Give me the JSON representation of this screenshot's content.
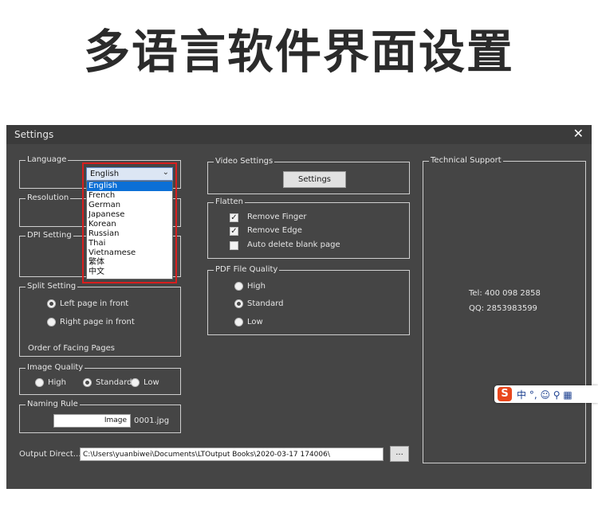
{
  "banner": {
    "title": "多语言软件界面设置"
  },
  "window": {
    "title": "Settings",
    "close": "✕"
  },
  "language": {
    "label": "Language",
    "selected": "English",
    "options": [
      "English",
      "French",
      "German",
      "Japanese",
      "Korean",
      "Russian",
      "Thai",
      "Vietnamese",
      "繁体",
      "中文"
    ]
  },
  "resolution": {
    "label": "Resolution"
  },
  "dpi": {
    "label": "DPI Setting"
  },
  "split": {
    "label": "Split Setting",
    "left": "Left page in front",
    "right": "Right page in front",
    "order": "Order of Facing Pages"
  },
  "image_quality": {
    "label": "Image Quality",
    "high": "High",
    "standard": "Standard",
    "low": "Low"
  },
  "naming": {
    "label": "Naming Rule",
    "value": "Image",
    "suffix": "0001.jpg"
  },
  "output": {
    "label": "Output Direct...",
    "value": "C:\\Users\\yuanbiwei\\Documents\\LTOutput Books\\2020-03-17 174006\\",
    "browse": "..."
  },
  "video": {
    "label": "Video Settings",
    "button": "Settings"
  },
  "flatten": {
    "label": "Flatten",
    "remove_finger": "Remove Finger",
    "remove_edge": "Remove Edge",
    "auto_delete": "Auto delete blank page"
  },
  "pdf": {
    "label": "PDF File Quality",
    "high": "High",
    "standard": "Standard",
    "low": "Low"
  },
  "support": {
    "label": "Technical Support",
    "tel": "Tel: 400 098 2858",
    "qq": "QQ: 2853983599"
  },
  "ime": {
    "logo": "S",
    "text": "中 °, ☺ ⚲ ▦"
  }
}
